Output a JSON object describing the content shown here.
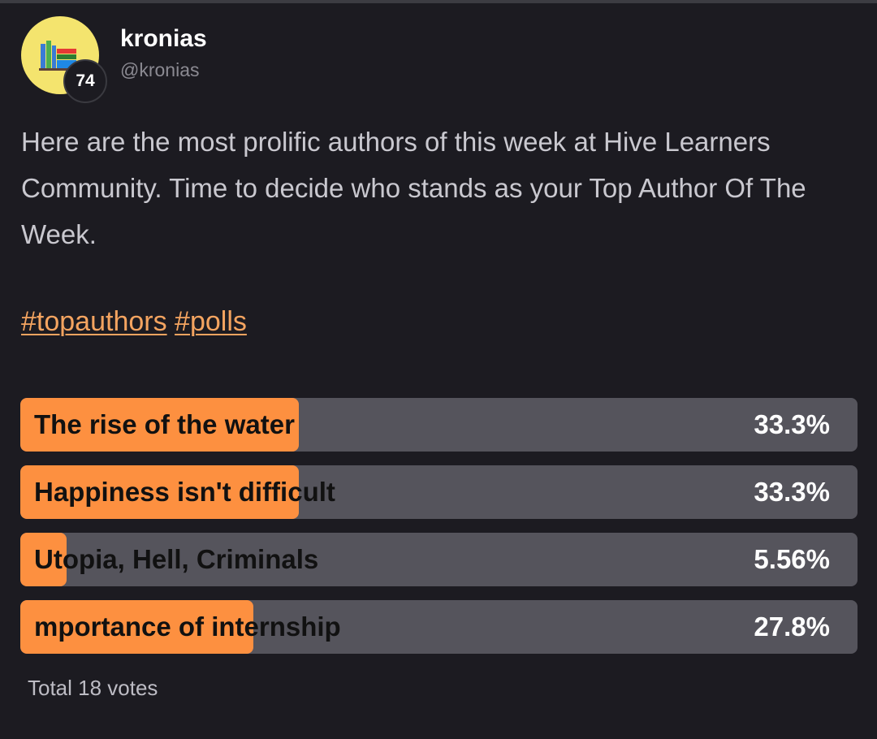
{
  "author": {
    "display_name": "kronias",
    "handle": "@kronias",
    "reputation": "74",
    "avatar_icon": "books-logo-icon"
  },
  "post": {
    "text": "Here are the most prolific authors of this week at Hive Learners Community. Time to decide who stands as your Top Author Of The Week.",
    "hashtags": [
      "#topauthors",
      "#polls"
    ]
  },
  "poll": {
    "options": [
      {
        "label": "The rise of the water",
        "percent": "33.3%",
        "value": 33.3
      },
      {
        "label": "Happiness isn't difficult",
        "percent": "33.3%",
        "value": 33.3
      },
      {
        "label": "Utopia, Hell, Criminals",
        "percent": "5.56%",
        "value": 5.56
      },
      {
        "label": "mportance of internship",
        "percent": "27.8%",
        "value": 27.8
      }
    ],
    "total_votes": "Total 18 votes"
  },
  "colors": {
    "background": "#1c1b21",
    "accent": "#fd9040",
    "poll_track": "#55545c",
    "hashtag": "#f4a460"
  }
}
